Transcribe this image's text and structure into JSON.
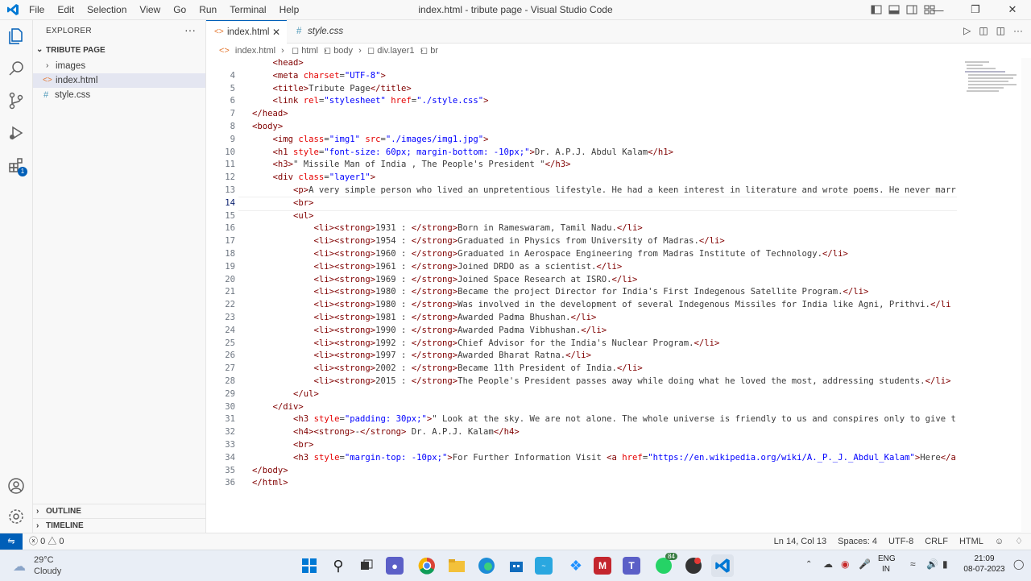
{
  "titlebar": {
    "menu": [
      "File",
      "Edit",
      "Selection",
      "View",
      "Go",
      "Run",
      "Terminal",
      "Help"
    ],
    "title": "index.html - tribute page - Visual Studio Code"
  },
  "sidebar": {
    "title": "EXPLORER",
    "folder": "TRIBUTE PAGE",
    "items": [
      {
        "label": "images",
        "type": "folder"
      },
      {
        "label": "index.html",
        "type": "html"
      },
      {
        "label": "style.css",
        "type": "css"
      }
    ],
    "outline": "OUTLINE",
    "timeline": "TIMELINE"
  },
  "tabs": [
    {
      "label": "index.html",
      "active": true
    },
    {
      "label": "style.css",
      "active": false
    }
  ],
  "breadcrumb": [
    "index.html",
    "html",
    "body",
    "div.layer1",
    "br"
  ],
  "editor": {
    "current_line": 14,
    "lines": [
      {
        "n": "",
        "html": "    <span class='t'>&lt;head&gt;</span>"
      },
      {
        "n": "4",
        "html": "    <span class='t'>&lt;meta</span> <span class='a'>charset</span>=<span class='v'>\"UTF-8\"</span><span class='t'>&gt;</span>"
      },
      {
        "n": "5",
        "html": "    <span class='t'>&lt;title&gt;</span>Tribute Page<span class='t'>&lt;/title&gt;</span>"
      },
      {
        "n": "6",
        "html": "    <span class='t'>&lt;link</span> <span class='a'>rel</span>=<span class='v'>\"stylesheet\"</span> <span class='a'>href</span>=<span class='v'>\"./style.css\"</span><span class='t'>&gt;</span>"
      },
      {
        "n": "7",
        "html": "<span class='t'>&lt;/head&gt;</span>"
      },
      {
        "n": "8",
        "html": "<span class='t'>&lt;body&gt;</span>"
      },
      {
        "n": "9",
        "html": "    <span class='t'>&lt;img</span> <span class='a'>class</span>=<span class='v'>\"img1\"</span> <span class='a'>src</span>=<span class='v'>\"./images/img1.jpg\"</span><span class='t'>&gt;</span>"
      },
      {
        "n": "10",
        "html": "    <span class='t'>&lt;h1</span> <span class='a'>style</span>=<span class='v'>\"font-size: 60px; margin-bottom: -10px;\"</span><span class='t'>&gt;</span>Dr. A.P.J. Abdul Kalam<span class='t'>&lt;/h1&gt;</span>"
      },
      {
        "n": "11",
        "html": "    <span class='t'>&lt;h3&gt;</span>\" Missile Man of India , The People's President \"<span class='t'>&lt;/h3&gt;</span>"
      },
      {
        "n": "12",
        "html": "    <span class='t'>&lt;div</span> <span class='a'>class</span>=<span class='v'>\"layer1\"</span><span class='t'>&gt;</span>"
      },
      {
        "n": "13",
        "html": "        <span class='t'>&lt;p&gt;</span>A very simple person who lived an unpretentious lifestyle. He had a keen interest in literature and wrote poems. He never marr"
      },
      {
        "n": "14",
        "html": "        <span class='t'>&lt;br&gt;</span>"
      },
      {
        "n": "15",
        "html": "        <span class='t'>&lt;ul&gt;</span>"
      },
      {
        "n": "16",
        "html": "            <span class='t'>&lt;li&gt;&lt;strong&gt;</span>1931 : <span class='t'>&lt;/strong&gt;</span>Born in Rameswaram, Tamil Nadu.<span class='t'>&lt;/li&gt;</span>"
      },
      {
        "n": "17",
        "html": "            <span class='t'>&lt;li&gt;&lt;strong&gt;</span>1954 : <span class='t'>&lt;/strong&gt;</span>Graduated in Physics from University of Madras.<span class='t'>&lt;/li&gt;</span>"
      },
      {
        "n": "18",
        "html": "            <span class='t'>&lt;li&gt;&lt;strong&gt;</span>1960 : <span class='t'>&lt;/strong&gt;</span>Graduated in Aerospace Engineering from Madras Institute of Technology.<span class='t'>&lt;/li&gt;</span>"
      },
      {
        "n": "19",
        "html": "            <span class='t'>&lt;li&gt;&lt;strong&gt;</span>1961 : <span class='t'>&lt;/strong&gt;</span>Joined DRDO as a scientist.<span class='t'>&lt;/li&gt;</span>"
      },
      {
        "n": "20",
        "html": "            <span class='t'>&lt;li&gt;&lt;strong&gt;</span>1969 : <span class='t'>&lt;/strong&gt;</span>Joined Space Research at ISRO.<span class='t'>&lt;/li&gt;</span>"
      },
      {
        "n": "21",
        "html": "            <span class='t'>&lt;li&gt;&lt;strong&gt;</span>1980 : <span class='t'>&lt;/strong&gt;</span>Became the project Director for India's First Indegenous Satellite Program.<span class='t'>&lt;/li&gt;</span>"
      },
      {
        "n": "22",
        "html": "            <span class='t'>&lt;li&gt;&lt;strong&gt;</span>1980 : <span class='t'>&lt;/strong&gt;</span>Was involved in the development of several Indegenous Missiles for India like Agni, Prithvi.<span class='t'>&lt;/li</span>"
      },
      {
        "n": "23",
        "html": "            <span class='t'>&lt;li&gt;&lt;strong&gt;</span>1981 : <span class='t'>&lt;/strong&gt;</span>Awarded Padma Bhushan.<span class='t'>&lt;/li&gt;</span>"
      },
      {
        "n": "24",
        "html": "            <span class='t'>&lt;li&gt;&lt;strong&gt;</span>1990 : <span class='t'>&lt;/strong&gt;</span>Awarded Padma Vibhushan.<span class='t'>&lt;/li&gt;</span>"
      },
      {
        "n": "25",
        "html": "            <span class='t'>&lt;li&gt;&lt;strong&gt;</span>1992 : <span class='t'>&lt;/strong&gt;</span>Chief Advisor for the India's Nuclear Program.<span class='t'>&lt;/li&gt;</span>"
      },
      {
        "n": "26",
        "html": "            <span class='t'>&lt;li&gt;&lt;strong&gt;</span>1997 : <span class='t'>&lt;/strong&gt;</span>Awarded Bharat Ratna.<span class='t'>&lt;/li&gt;</span>"
      },
      {
        "n": "27",
        "html": "            <span class='t'>&lt;li&gt;&lt;strong&gt;</span>2002 : <span class='t'>&lt;/strong&gt;</span>Became 11th President of India.<span class='t'>&lt;/li&gt;</span>"
      },
      {
        "n": "28",
        "html": "            <span class='t'>&lt;li&gt;&lt;strong&gt;</span>2015 : <span class='t'>&lt;/strong&gt;</span>The People's President passes away while doing what he loved the most, addressing students.<span class='t'>&lt;/li&gt;</span>"
      },
      {
        "n": "29",
        "html": "        <span class='t'>&lt;/ul&gt;</span>"
      },
      {
        "n": "30",
        "html": "    <span class='t'>&lt;/div&gt;</span>"
      },
      {
        "n": "31",
        "html": "        <span class='t'>&lt;h3</span> <span class='a'>style</span>=<span class='v'>\"padding: 30px;\"</span><span class='t'>&gt;</span>\" Look at the sky. We are not alone. The whole universe is friendly to us and conspires only to give t"
      },
      {
        "n": "32",
        "html": "        <span class='t'>&lt;h4&gt;&lt;strong&gt;</span>-<span class='t'>&lt;/strong&gt;</span> Dr. A.P.J. Kalam<span class='t'>&lt;/h4&gt;</span>"
      },
      {
        "n": "33",
        "html": "        <span class='t'>&lt;br&gt;</span>"
      },
      {
        "n": "34",
        "html": "        <span class='t'>&lt;h3</span> <span class='a'>style</span>=<span class='v'>\"margin-top: -10px;\"</span><span class='t'>&gt;</span>For Further Information Visit <span class='t'>&lt;a</span> <span class='a'>href</span>=<span class='v'>\"https://en.wikipedia.org/wiki/A._P._J._Abdul_Kalam\"</span><span class='t'>&gt;</span>Here<span class='t'>&lt;/a</span>"
      },
      {
        "n": "35",
        "html": "<span class='t'>&lt;/body&gt;</span>"
      },
      {
        "n": "36",
        "html": "<span class='t'>&lt;/html&gt;</span>"
      }
    ]
  },
  "statusbar": {
    "problems": "0",
    "warnings": "0",
    "position": "Ln 14, Col 13",
    "spaces": "Spaces: 4",
    "encoding": "UTF-8",
    "eol": "CRLF",
    "language": "HTML"
  },
  "taskbar": {
    "temp": "29°C",
    "condition": "Cloudy",
    "whatsapp_badge": "84",
    "lang1": "ENG",
    "lang2": "IN",
    "time": "21:09",
    "date": "08-07-2023",
    "extension_badge": "1"
  },
  "colors": {
    "accent": "#005fb8",
    "tag": "#800000",
    "attr": "#e50000",
    "value": "#0000ff"
  }
}
